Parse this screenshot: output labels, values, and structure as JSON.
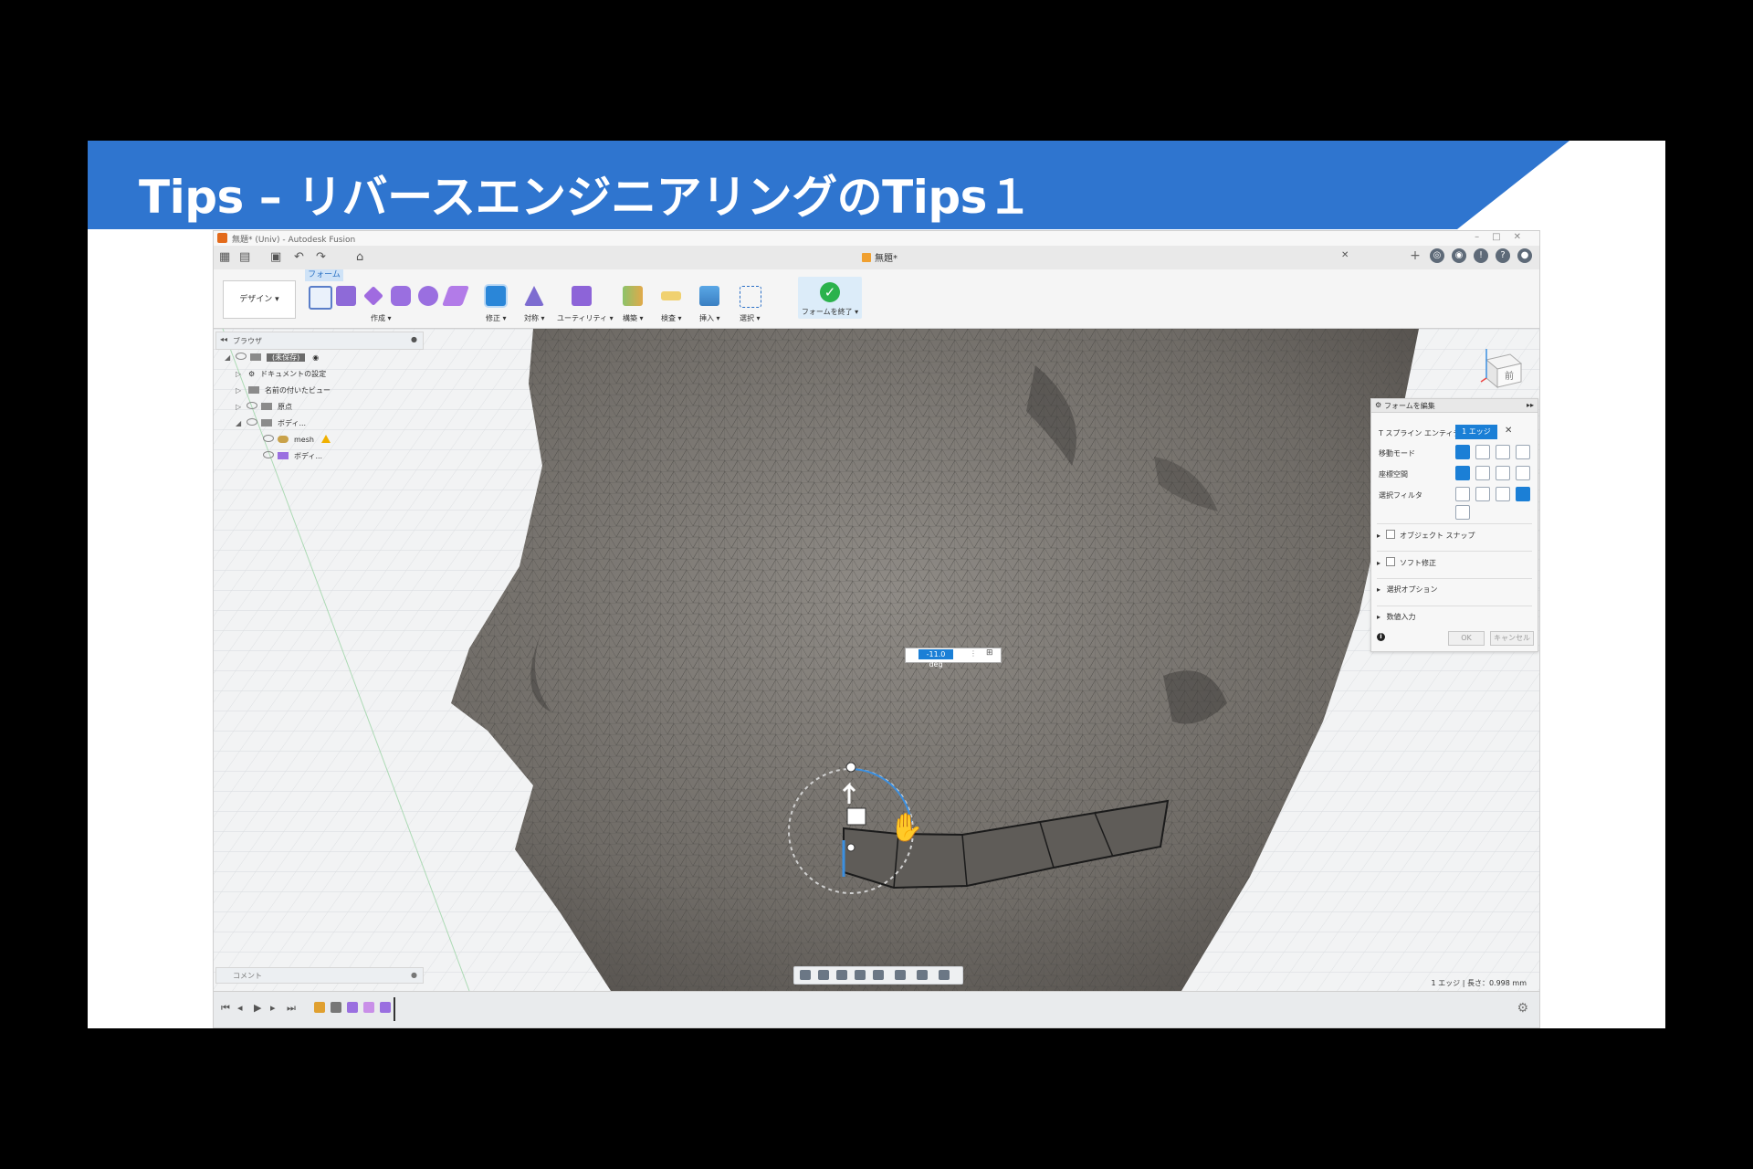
{
  "slide": {
    "title": "Tips – リバースエンジニアリングのTips１",
    "accent_color": "#2f75cf"
  },
  "app": {
    "window_title": "無題* (Univ) - Autodesk Fusion",
    "document_tab": "無題*",
    "design_button": "デザイン ▾",
    "form_tab": "フォーム",
    "ribbon_groups": [
      "作成 ▾",
      "修正 ▾",
      "対称 ▾",
      "ユーティリティ ▾",
      "構築 ▾",
      "検査 ▾",
      "挿入 ▾",
      "選択 ▾"
    ],
    "finish_label": "フォームを終了 ▾",
    "browser_label": "ブラウザ",
    "tree": [
      {
        "label": "(未保存)",
        "selected": true
      },
      {
        "label": "ドキュメントの設定"
      },
      {
        "label": "名前の付いたビュー"
      },
      {
        "label": "原点"
      },
      {
        "label": "ボディ..."
      },
      {
        "label": "mesh",
        "warning": true
      },
      {
        "label": "ボディ..."
      }
    ],
    "viewcube_label": "前",
    "edit_form_panel": {
      "title": "フォームを編集",
      "rows": [
        "T スプライン エンティティ",
        "移動モード",
        "座標空間",
        "選択フィルタ"
      ],
      "entity_chip": "1 エッジ",
      "sections": [
        "オブジェクト スナップ",
        "ソフト修正",
        "選択オプション",
        "数値入力"
      ],
      "ok": "OK",
      "cancel": "キャンセル"
    },
    "angle_value": "-11.0 deg",
    "comment_label": "コメント",
    "status_text": "1 エッジ | 長さ：0.998 mm"
  }
}
